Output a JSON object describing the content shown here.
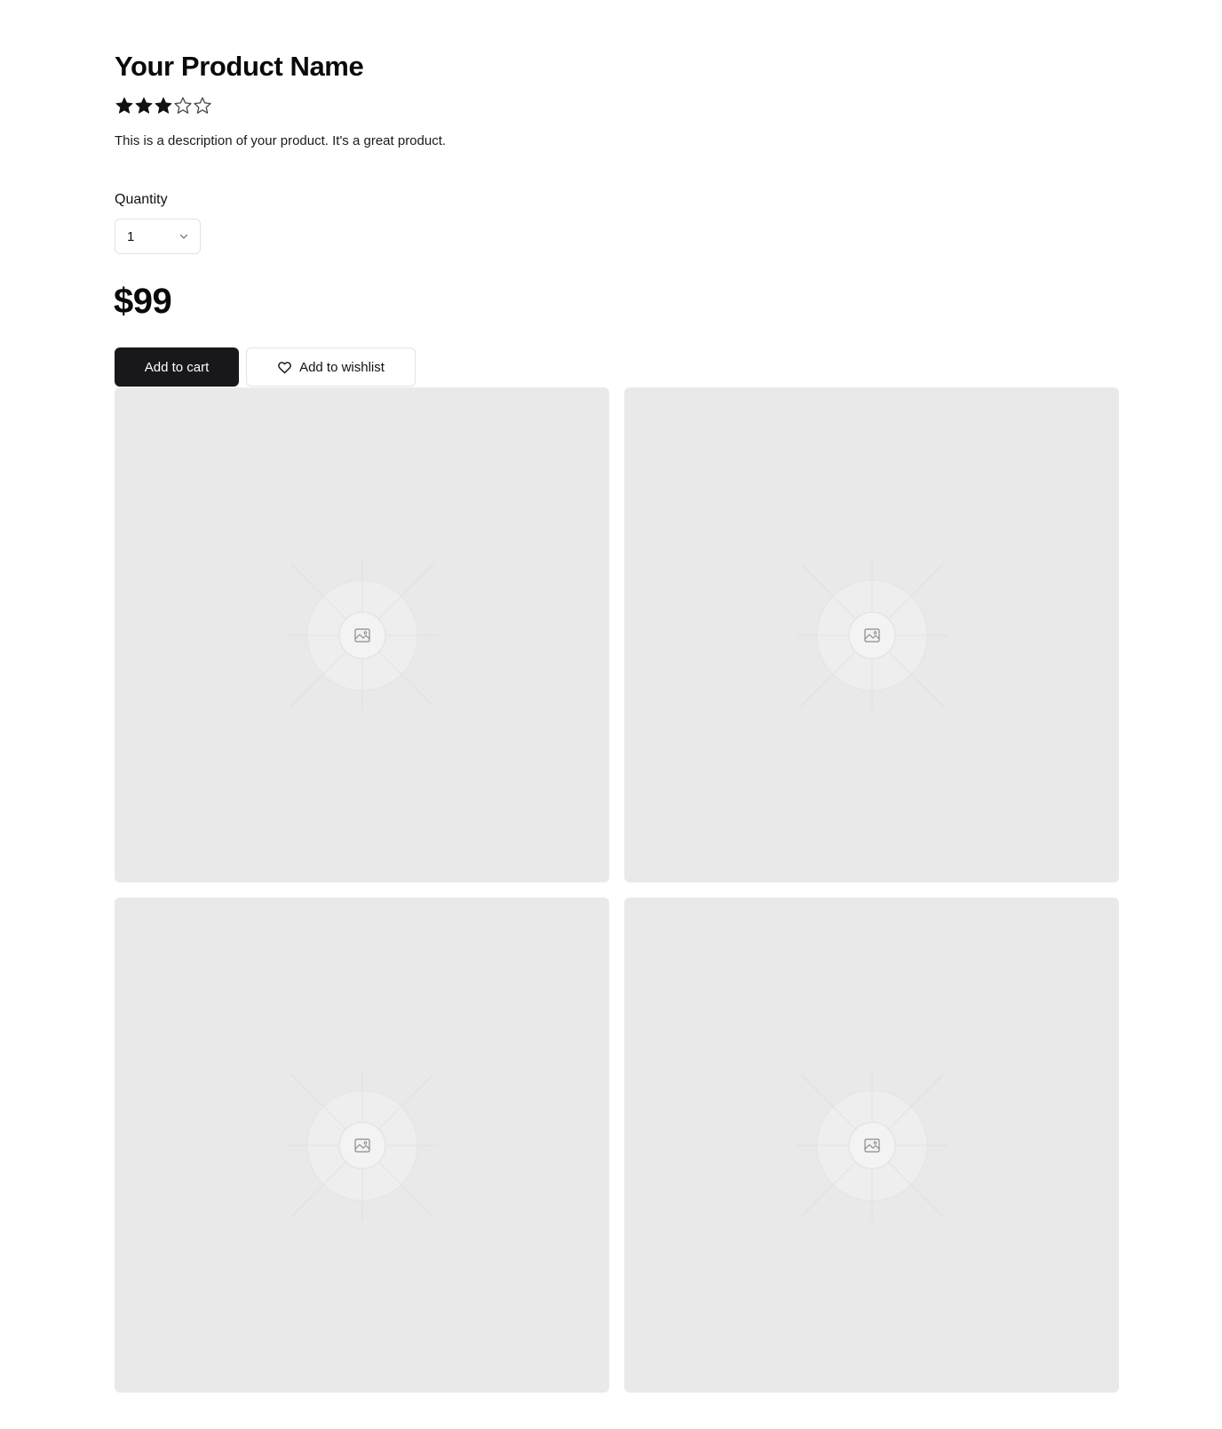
{
  "product": {
    "name": "Your Product Name",
    "rating": 3,
    "rating_max": 5,
    "description": "This is a description of your product. It's a great product.",
    "price": "$99"
  },
  "quantity": {
    "label": "Quantity",
    "selected_value": "1"
  },
  "actions": {
    "add_to_cart_label": "Add to cart",
    "add_to_wishlist_label": "Add to wishlist"
  },
  "gallery": {
    "images": [
      {
        "icon": "image-icon"
      },
      {
        "icon": "image-icon"
      },
      {
        "icon": "image-icon"
      },
      {
        "icon": "image-icon"
      }
    ]
  },
  "colors": {
    "primary_button": "#18181b",
    "image_placeholder": "#e9e9e9",
    "star_filled": "#111111",
    "star_empty_stroke": "#444444"
  }
}
